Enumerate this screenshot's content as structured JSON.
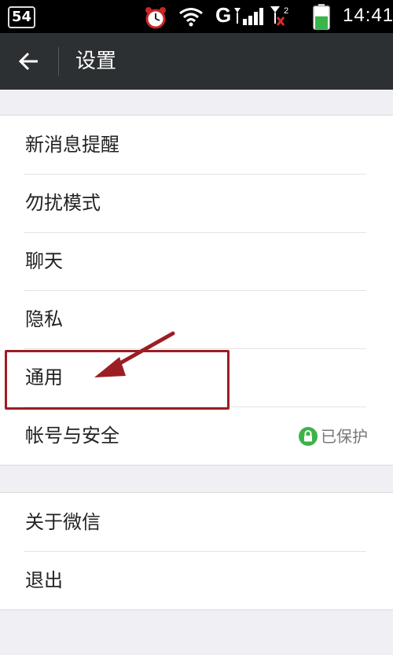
{
  "status_bar": {
    "badge": "54",
    "network": "G",
    "signal_extra": "2",
    "time": "14:41",
    "icons": [
      "alarm-clock-icon",
      "wifi-icon",
      "signal-icon",
      "battery-icon"
    ],
    "battery_level": 0.6,
    "battery_color": "#39b54a"
  },
  "header": {
    "title": "设置",
    "back_icon": "back-arrow-icon",
    "background": "#2d3032"
  },
  "menu": {
    "group1": [
      {
        "label": "新消息提醒"
      },
      {
        "label": "勿扰模式"
      },
      {
        "label": "聊天"
      },
      {
        "label": "隐私"
      },
      {
        "label": "通用"
      },
      {
        "label": "帐号与安全",
        "status": "已保护",
        "status_icon": "lock-icon",
        "status_color": "#3cb34a"
      }
    ],
    "group2": [
      {
        "label": "关于微信"
      },
      {
        "label": "退出"
      }
    ]
  },
  "annotation": {
    "highlighted_item": "通用",
    "color": "#9c1d24"
  }
}
